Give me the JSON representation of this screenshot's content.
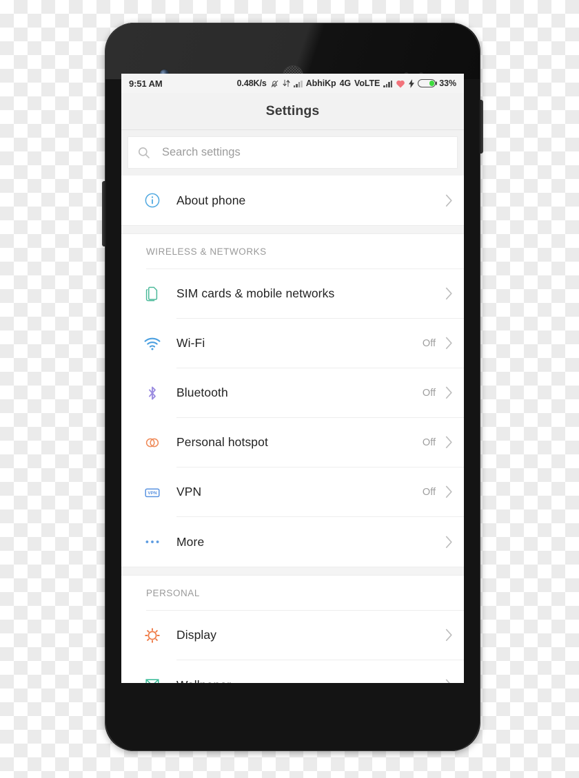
{
  "status_bar": {
    "clock": "9:51 AM",
    "data_rate": "0.48K/s",
    "silent_icon": "bell-muted-icon",
    "transfer_icon": "data-transfer-icon",
    "signal_icon_1": "signal-bars-icon",
    "carrier": "AbhiKp",
    "network_type": "4G",
    "volte": "VoLTE",
    "signal_icon_2": "signal-bars-icon",
    "heart_icon": "heart-icon",
    "charging_icon": "charging-bolt-icon",
    "battery_icon": "battery-icon",
    "battery_percent": "33%",
    "battery_level": 33,
    "battery_color": "#3ddb3d"
  },
  "app_bar": {
    "title": "Settings"
  },
  "search": {
    "icon": "search-icon",
    "placeholder": "Search settings",
    "value": ""
  },
  "groups": [
    {
      "header": null,
      "rows": [
        {
          "label": "About phone",
          "value": "",
          "icon": "info-circle-icon",
          "icon_color": "#4fa8e0",
          "chevron": "chevron-right-icon"
        }
      ]
    },
    {
      "header": "WIRELESS & NETWORKS",
      "rows": [
        {
          "label": "SIM cards & mobile networks",
          "value": "",
          "icon": "sim-cards-icon",
          "icon_color": "#4cba9a",
          "chevron": "chevron-right-icon"
        },
        {
          "label": "Wi-Fi",
          "value": "Off",
          "icon": "wifi-icon",
          "icon_color": "#4a9fe0",
          "chevron": "chevron-right-icon"
        },
        {
          "label": "Bluetooth",
          "value": "Off",
          "icon": "bluetooth-icon",
          "icon_color": "#9b8ce0",
          "chevron": "chevron-right-icon"
        },
        {
          "label": "Personal hotspot",
          "value": "Off",
          "icon": "personal-hotspot-icon",
          "icon_color": "#ef8a58",
          "chevron": "chevron-right-icon"
        },
        {
          "label": "VPN",
          "value": "Off",
          "icon": "vpn-icon",
          "icon_color": "#5a93e0",
          "icon_text": "VPN",
          "chevron": "chevron-right-icon"
        },
        {
          "label": "More",
          "value": "",
          "icon": "more-dots-icon",
          "icon_color": "#5a9ae0",
          "chevron": "chevron-right-icon"
        }
      ]
    },
    {
      "header": "PERSONAL",
      "rows": [
        {
          "label": "Display",
          "value": "",
          "icon": "display-sun-icon",
          "icon_color": "#ef7a45",
          "chevron": "chevron-right-icon"
        },
        {
          "label": "Wallpaper",
          "value": "",
          "icon": "wallpaper-icon",
          "icon_color": "#3fbd9a",
          "chevron": "chevron-right-icon"
        }
      ]
    }
  ],
  "device": {
    "front_camera": "front-camera",
    "earpiece": "earpiece-speaker",
    "proximity_sensor": "proximity-sensor",
    "light_sensor": "light-sensor",
    "volume_button": "volume-rocker-button",
    "power_button": "power-button"
  }
}
